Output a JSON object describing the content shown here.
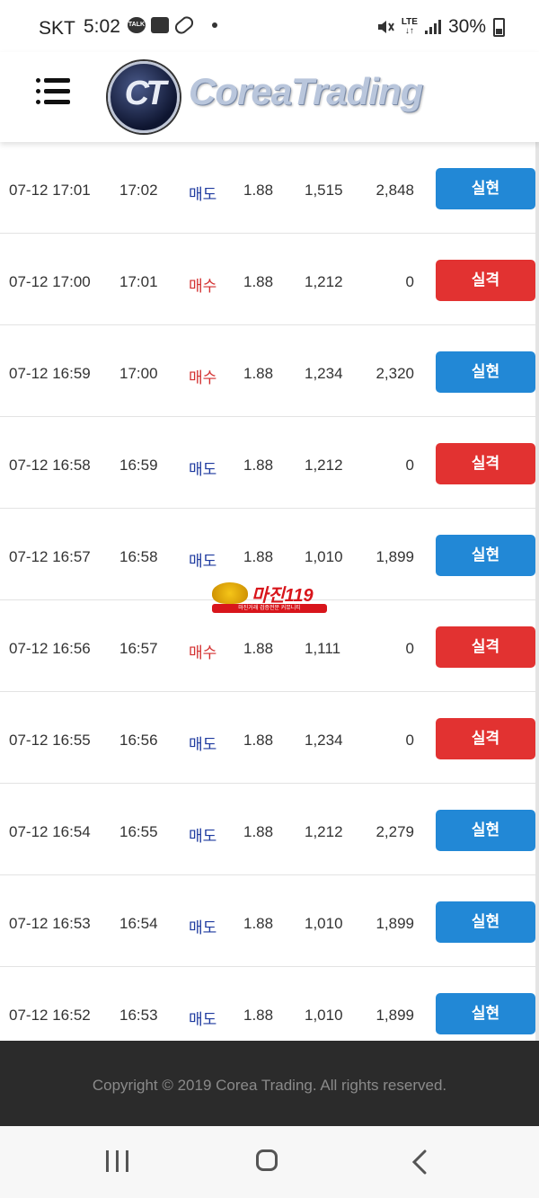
{
  "status_bar": {
    "carrier": "SKT",
    "time": "5:02",
    "talk_badge": "TALK",
    "network": "LTE",
    "battery": "30%"
  },
  "header": {
    "logo_mark": "CT",
    "logo_text": "CoreaTrading"
  },
  "trades": [
    {
      "datetime": "07-12 17:01",
      "time": "17:02",
      "side": "매도",
      "side_type": "sell",
      "rate": "1.88",
      "amount": "1,515",
      "profit": "2,848",
      "result": "실현",
      "result_type": "win"
    },
    {
      "datetime": "07-12 17:00",
      "time": "17:01",
      "side": "매수",
      "side_type": "buy",
      "rate": "1.88",
      "amount": "1,212",
      "profit": "0",
      "result": "실격",
      "result_type": "lose"
    },
    {
      "datetime": "07-12 16:59",
      "time": "17:00",
      "side": "매수",
      "side_type": "buy",
      "rate": "1.88",
      "amount": "1,234",
      "profit": "2,320",
      "result": "실현",
      "result_type": "win"
    },
    {
      "datetime": "07-12 16:58",
      "time": "16:59",
      "side": "매도",
      "side_type": "sell",
      "rate": "1.88",
      "amount": "1,212",
      "profit": "0",
      "result": "실격",
      "result_type": "lose"
    },
    {
      "datetime": "07-12 16:57",
      "time": "16:58",
      "side": "매도",
      "side_type": "sell",
      "rate": "1.88",
      "amount": "1,010",
      "profit": "1,899",
      "result": "실현",
      "result_type": "win"
    },
    {
      "datetime": "07-12 16:56",
      "time": "16:57",
      "side": "매수",
      "side_type": "buy",
      "rate": "1.88",
      "amount": "1,111",
      "profit": "0",
      "result": "실격",
      "result_type": "lose"
    },
    {
      "datetime": "07-12 16:55",
      "time": "16:56",
      "side": "매도",
      "side_type": "sell",
      "rate": "1.88",
      "amount": "1,234",
      "profit": "0",
      "result": "실격",
      "result_type": "lose"
    },
    {
      "datetime": "07-12 16:54",
      "time": "16:55",
      "side": "매도",
      "side_type": "sell",
      "rate": "1.88",
      "amount": "1,212",
      "profit": "2,279",
      "result": "실현",
      "result_type": "win"
    },
    {
      "datetime": "07-12 16:53",
      "time": "16:54",
      "side": "매도",
      "side_type": "sell",
      "rate": "1.88",
      "amount": "1,010",
      "profit": "1,899",
      "result": "실현",
      "result_type": "win"
    },
    {
      "datetime": "07-12 16:52",
      "time": "16:53",
      "side": "매도",
      "side_type": "sell",
      "rate": "1.88",
      "amount": "1,010",
      "profit": "1,899",
      "result": "실현",
      "result_type": "win"
    }
  ],
  "watermark": {
    "title": "마진119",
    "subtitle": "마진거래 검증전문 커뮤니티"
  },
  "footer": {
    "copyright": "Copyright © 2019 Corea Trading. All rights reserved."
  },
  "colors": {
    "win_button": "#2288d6",
    "lose_button": "#e23231",
    "sell_text": "#1e3a9f",
    "buy_text": "#d32f2f",
    "footer_bg": "#2b2b2b"
  }
}
